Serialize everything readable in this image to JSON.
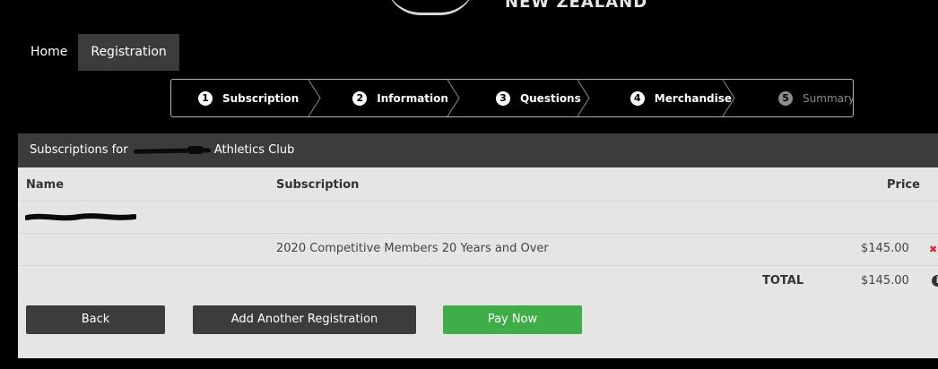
{
  "top_nav": {
    "home": "Home",
    "registration": "Registration"
  },
  "steps": [
    {
      "num": "1",
      "label": "Subscription",
      "enabled": true
    },
    {
      "num": "2",
      "label": "Information",
      "enabled": true
    },
    {
      "num": "3",
      "label": "Questions",
      "enabled": true
    },
    {
      "num": "4",
      "label": "Merchandise",
      "enabled": true
    },
    {
      "num": "5",
      "label": "Summary",
      "enabled": false
    }
  ],
  "panel": {
    "title_prefix": "Subscriptions for",
    "title_suffix": "Athletics Club"
  },
  "table": {
    "headers": {
      "name": "Name",
      "subscription": "Subscription",
      "price": "Price"
    },
    "rows": [
      {
        "subscription": "2020 Competitive Members 20 Years and Over",
        "price": "$145.00"
      }
    ],
    "total_label": "TOTAL",
    "total_value": "$145.00"
  },
  "buttons": {
    "back": "Back",
    "add_another": "Add Another Registration",
    "pay_now": "Pay Now"
  },
  "icons": {
    "remove": "close-icon",
    "info": "info-icon"
  },
  "colors": {
    "background": "#000000",
    "panel_header": "#3c3c3c",
    "panel_body": "#e5e5e5",
    "pay_button": "#3fae49",
    "remove_icon": "#d9242c"
  }
}
